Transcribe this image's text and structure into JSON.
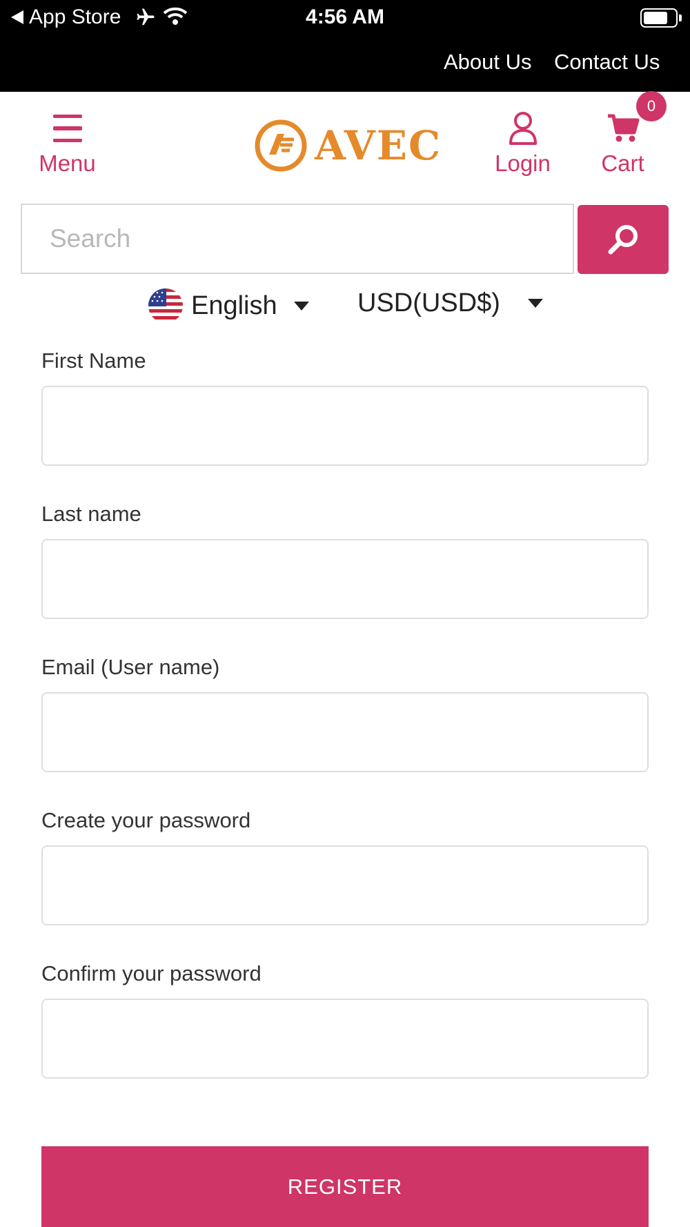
{
  "status_bar": {
    "back_label": "App Store",
    "time": "4:56 AM"
  },
  "top_links": {
    "about": "About Us",
    "contact": "Contact Us"
  },
  "header": {
    "menu_label": "Menu",
    "login_label": "Login",
    "cart_label": "Cart",
    "cart_count": "0",
    "logo_text": "AVEC"
  },
  "search": {
    "placeholder": "Search",
    "value": ""
  },
  "language": {
    "selected": "English"
  },
  "currency": {
    "selected": "USD(USD$)"
  },
  "form": {
    "fields": [
      {
        "label": "First Name",
        "value": ""
      },
      {
        "label": "Last name",
        "value": ""
      },
      {
        "label": "Email (User name)",
        "value": ""
      },
      {
        "label": "Create your password",
        "value": ""
      },
      {
        "label": "Confirm your password",
        "value": ""
      }
    ],
    "submit_label": "REGISTER"
  },
  "colors": {
    "accent": "#cf3567",
    "logo": "#e58a2b",
    "topbar": "#000000"
  },
  "icons": [
    "back-triangle-icon",
    "airplane-icon",
    "wifi-icon",
    "battery-icon",
    "hamburger-icon",
    "user-icon",
    "cart-icon",
    "search-icon",
    "us-flag-icon",
    "caret-down-icon"
  ]
}
